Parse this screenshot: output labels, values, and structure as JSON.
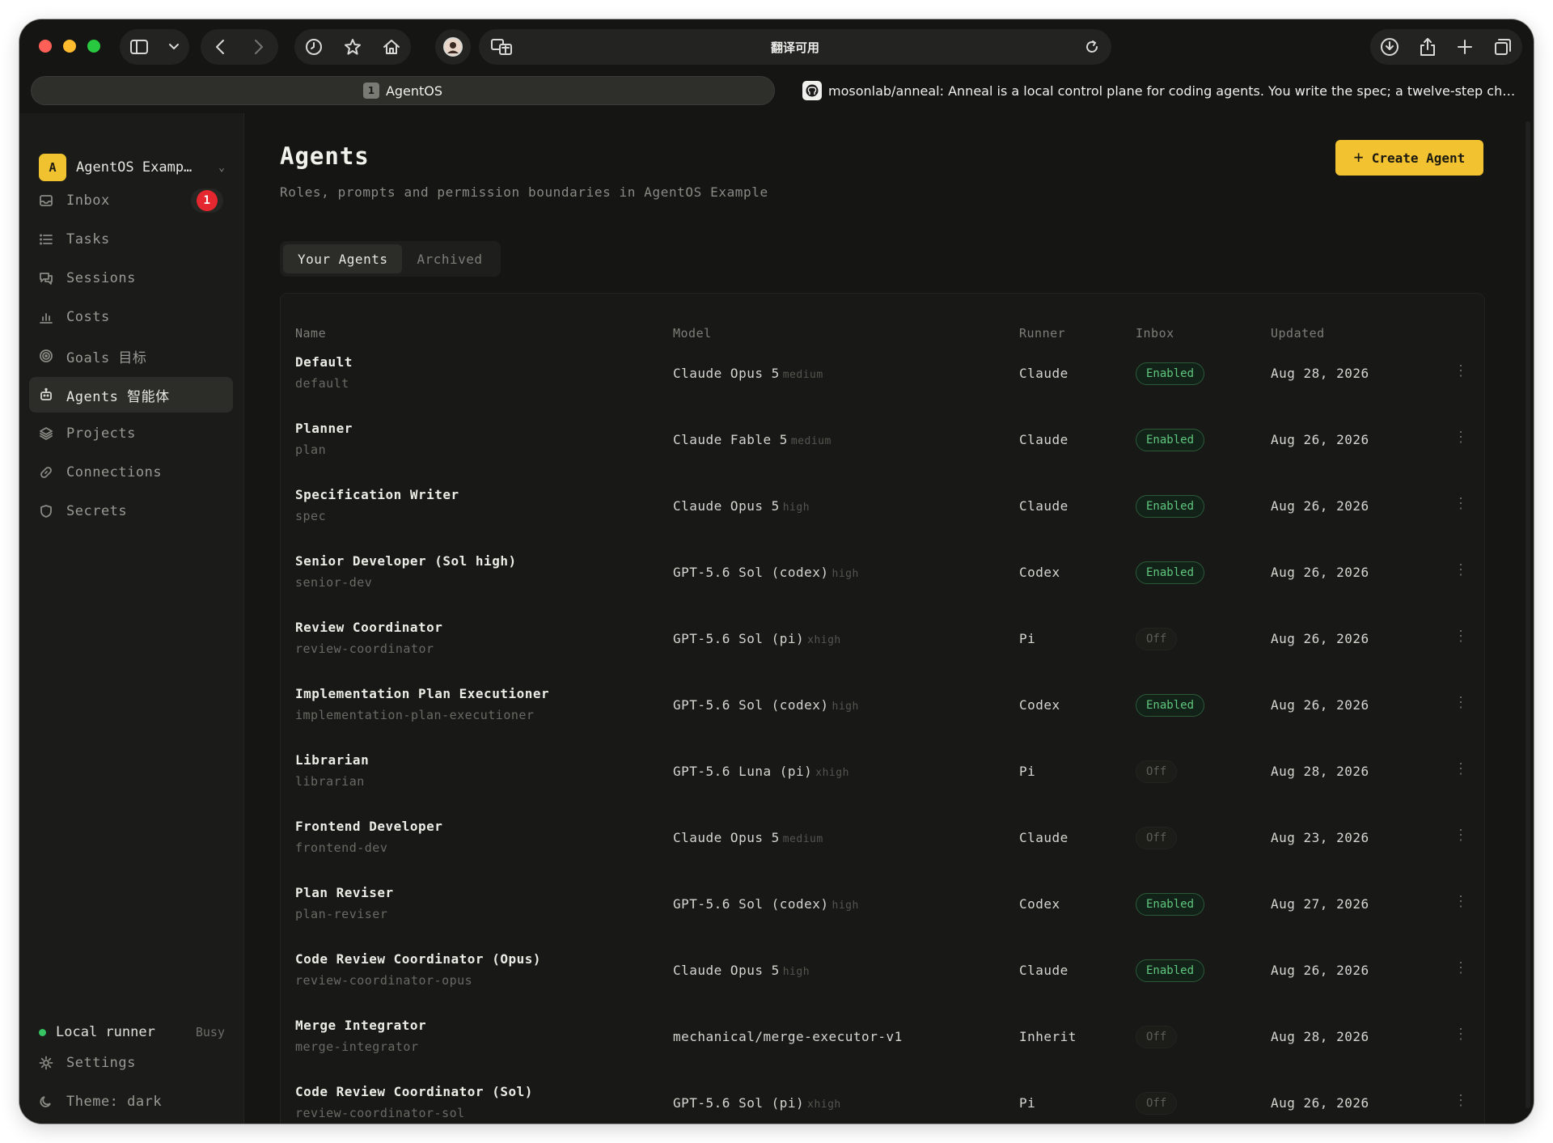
{
  "browser": {
    "address": "翻译可用",
    "tabs": [
      {
        "num": "1",
        "title": "AgentOS"
      },
      {
        "title": "mosonlab/anneal: Anneal is a local control plane for coding agents. You write the spec; a twelve-step chain..."
      }
    ]
  },
  "sidebar": {
    "workspace_initial": "A",
    "workspace_name": "AgentOS Examp…",
    "items": [
      {
        "label": "Inbox",
        "icon": "inbox-icon",
        "badge": "1"
      },
      {
        "label": "Tasks",
        "icon": "list-icon"
      },
      {
        "label": "Sessions",
        "icon": "chat-icon"
      },
      {
        "label": "Costs",
        "icon": "bar-chart-icon"
      },
      {
        "label": "Goals  目标",
        "icon": "target-icon"
      },
      {
        "label": "Agents  智能体",
        "icon": "robot-icon",
        "active": true
      },
      {
        "label": "Projects",
        "icon": "layers-icon"
      },
      {
        "label": "Connections",
        "icon": "link-icon"
      },
      {
        "label": "Secrets",
        "icon": "shield-icon"
      }
    ],
    "runner_label": "Local runner",
    "runner_status": "Busy",
    "settings_label": "Settings",
    "theme_label": "Theme: dark"
  },
  "main": {
    "title": "Agents",
    "subtitle": "Roles, prompts and permission boundaries in AgentOS Example",
    "create_button": "Create Agent",
    "tabs": [
      "Your Agents",
      "Archived"
    ],
    "columns": [
      "Name",
      "Model",
      "Runner",
      "Inbox",
      "Updated"
    ],
    "rows": [
      {
        "name": "Default",
        "slug": "default",
        "model": "Claude Opus 5",
        "effort": "medium",
        "runner": "Claude",
        "inbox": "Enabled",
        "updated": "Aug 28, 2026"
      },
      {
        "name": "Planner",
        "slug": "plan",
        "model": "Claude Fable 5",
        "effort": "medium",
        "runner": "Claude",
        "inbox": "Enabled",
        "updated": "Aug 26, 2026"
      },
      {
        "name": "Specification Writer",
        "slug": "spec",
        "model": "Claude Opus 5",
        "effort": "high",
        "runner": "Claude",
        "inbox": "Enabled",
        "updated": "Aug 26, 2026"
      },
      {
        "name": "Senior Developer (Sol high)",
        "slug": "senior-dev",
        "model": "GPT-5.6 Sol (codex)",
        "effort": "high",
        "runner": "Codex",
        "inbox": "Enabled",
        "updated": "Aug 26, 2026"
      },
      {
        "name": "Review Coordinator",
        "slug": "review-coordinator",
        "model": "GPT-5.6 Sol (pi)",
        "effort": "xhigh",
        "runner": "Pi",
        "inbox": "Off",
        "updated": "Aug 26, 2026"
      },
      {
        "name": "Implementation Plan Executioner",
        "slug": "implementation-plan-executioner",
        "model": "GPT-5.6 Sol (codex)",
        "effort": "high",
        "runner": "Codex",
        "inbox": "Enabled",
        "updated": "Aug 26, 2026"
      },
      {
        "name": "Librarian",
        "slug": "librarian",
        "model": "GPT-5.6 Luna (pi)",
        "effort": "xhigh",
        "runner": "Pi",
        "inbox": "Off",
        "updated": "Aug 28, 2026"
      },
      {
        "name": "Frontend Developer",
        "slug": "frontend-dev",
        "model": "Claude Opus 5",
        "effort": "medium",
        "runner": "Claude",
        "inbox": "Off",
        "updated": "Aug 23, 2026"
      },
      {
        "name": "Plan Reviser",
        "slug": "plan-reviser",
        "model": "GPT-5.6 Sol (codex)",
        "effort": "high",
        "runner": "Codex",
        "inbox": "Enabled",
        "updated": "Aug 27, 2026"
      },
      {
        "name": "Code Review Coordinator (Opus)",
        "slug": "review-coordinator-opus",
        "model": "Claude Opus 5",
        "effort": "high",
        "runner": "Claude",
        "inbox": "Enabled",
        "updated": "Aug 26, 2026"
      },
      {
        "name": "Merge Integrator",
        "slug": "merge-integrator",
        "model": "mechanical/merge-executor-v1",
        "effort": "",
        "runner": "Inherit",
        "inbox": "Off",
        "updated": "Aug 28, 2026"
      },
      {
        "name": "Code Review Coordinator (Sol)",
        "slug": "review-coordinator-sol",
        "model": "GPT-5.6 Sol (pi)",
        "effort": "xhigh",
        "runner": "Pi",
        "inbox": "Off",
        "updated": "Aug 26, 2026"
      }
    ]
  },
  "colors": {
    "accent": "#f2c230",
    "enabled": "#5fc77d",
    "badge": "#e5282f",
    "runner_online": "#36c463"
  }
}
